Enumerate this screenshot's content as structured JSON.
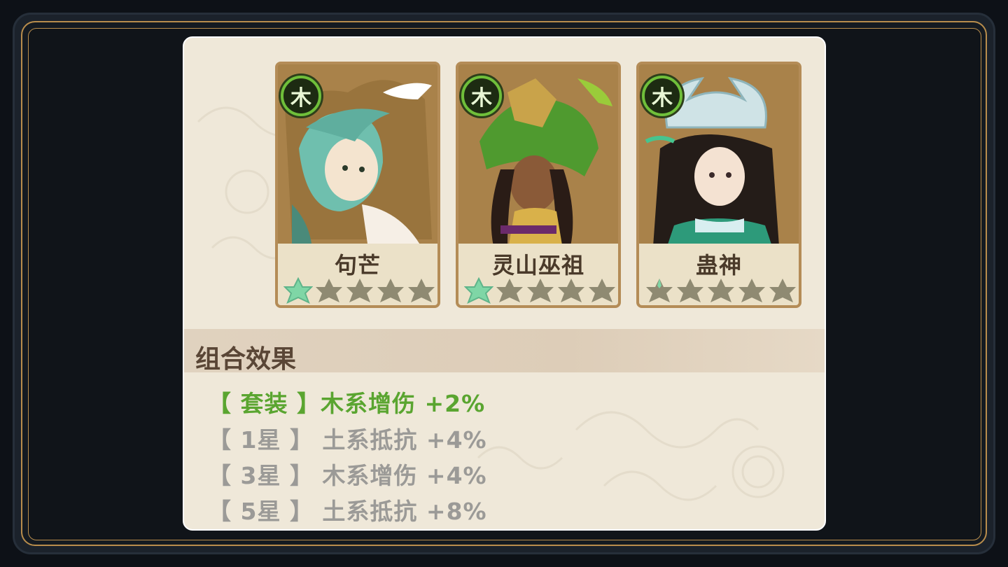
{
  "cards": [
    {
      "name": "句芒",
      "element": "木",
      "stars_filled": 1,
      "stars_total": 5
    },
    {
      "name": "灵山巫祖",
      "element": "木",
      "stars_filled": 1,
      "stars_total": 5
    },
    {
      "name": "蛊神",
      "element": "木",
      "stars_filled": 0,
      "stars_total": 5
    }
  ],
  "combo": {
    "title": "组合效果",
    "effects": [
      {
        "text": "【 套装 】木系增伤 +2%",
        "active": true
      },
      {
        "text": "【 1星 】 土系抵抗 +4%",
        "active": false
      },
      {
        "text": "【 3星 】 木系增伤 +4%",
        "active": false
      },
      {
        "text": "【 5星 】 土系抵抗 +8%",
        "active": false
      }
    ]
  },
  "colors": {
    "active_effect": "#5aa530",
    "inactive_effect": "#9b9a97",
    "element_wood": "#6fbf3a",
    "star_filled": "#7fd6a6",
    "star_empty": "#8f8a72"
  }
}
